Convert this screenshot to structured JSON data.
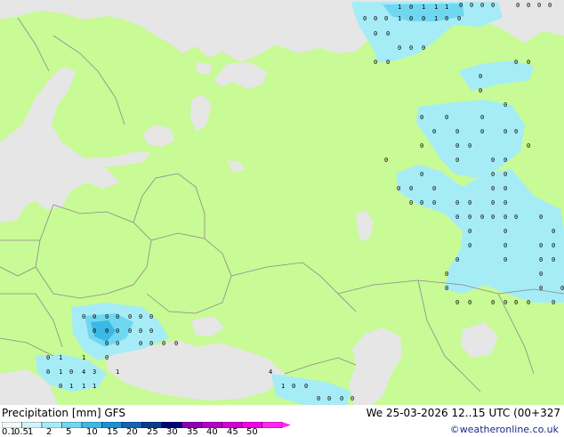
{
  "legend": {
    "title": "Precipitation [mm]  GFS",
    "datetime": "We 25-03-2026 12..15 UTC (00+327",
    "credit": "©weatheronline.co.uk",
    "scale_ticks": [
      "0.1",
      "0.5",
      "1",
      "2",
      "5",
      "10",
      "15",
      "20",
      "25",
      "30",
      "35",
      "40",
      "45",
      "50"
    ],
    "scale_colors": [
      "#f5fbfe",
      "#d2f3fb",
      "#a6ecf7",
      "#6fd8f0",
      "#3cb8e6",
      "#1e90d2",
      "#1464b4",
      "#0a3c8c",
      "#000078",
      "#8c00b4",
      "#b400c8",
      "#d200d2",
      "#f000e6",
      "#ff28f0"
    ]
  },
  "map": {
    "land_color": "#c8fa96",
    "sea_color": "#e6e6e6",
    "border_color": "#8a8a8a",
    "values": [
      "0",
      "0",
      "0",
      "1",
      "0",
      "0",
      "1",
      "0",
      "0",
      "1",
      "0",
      "1",
      "1",
      "1",
      "0",
      "0",
      "0",
      "0",
      "0",
      "0",
      "0",
      "0",
      "0",
      "0",
      "0",
      "0",
      "0",
      "0",
      "0",
      "0",
      "0",
      "0",
      "0",
      "0",
      "0",
      "0",
      "0",
      "0",
      "0",
      "0",
      "0",
      "0",
      "0",
      "0",
      "0",
      "0",
      "0",
      "0",
      "0",
      "0",
      "0",
      "0",
      "0",
      "0",
      "0",
      "0",
      "0",
      "0",
      "0",
      "0",
      "0",
      "0",
      "0",
      "0",
      "0",
      "0",
      "0",
      "0",
      "0",
      "0",
      "0",
      "0",
      "0",
      "0",
      "0",
      "0",
      "0",
      "0",
      "0",
      "0",
      "0",
      "0",
      "0",
      "0",
      "0",
      "0",
      "0",
      "0",
      "0",
      "0",
      "0",
      "0",
      "0",
      "0",
      "0",
      "0",
      "0",
      "0",
      "0",
      "0",
      "0",
      "0",
      "0",
      "0",
      "0",
      "0",
      "0",
      "1",
      "1",
      "0",
      "0",
      "1",
      "0",
      "4",
      "3",
      "1",
      "0",
      "1",
      "1",
      "1",
      "4",
      "1",
      "0",
      "0",
      "0",
      "0",
      "0",
      "0",
      "0",
      "0",
      "0",
      "0",
      "0",
      "0",
      "0",
      "0",
      "0",
      "0",
      "0",
      "1",
      "0",
      "0",
      "0",
      "0",
      "0",
      "0",
      "0",
      "0"
    ]
  }
}
